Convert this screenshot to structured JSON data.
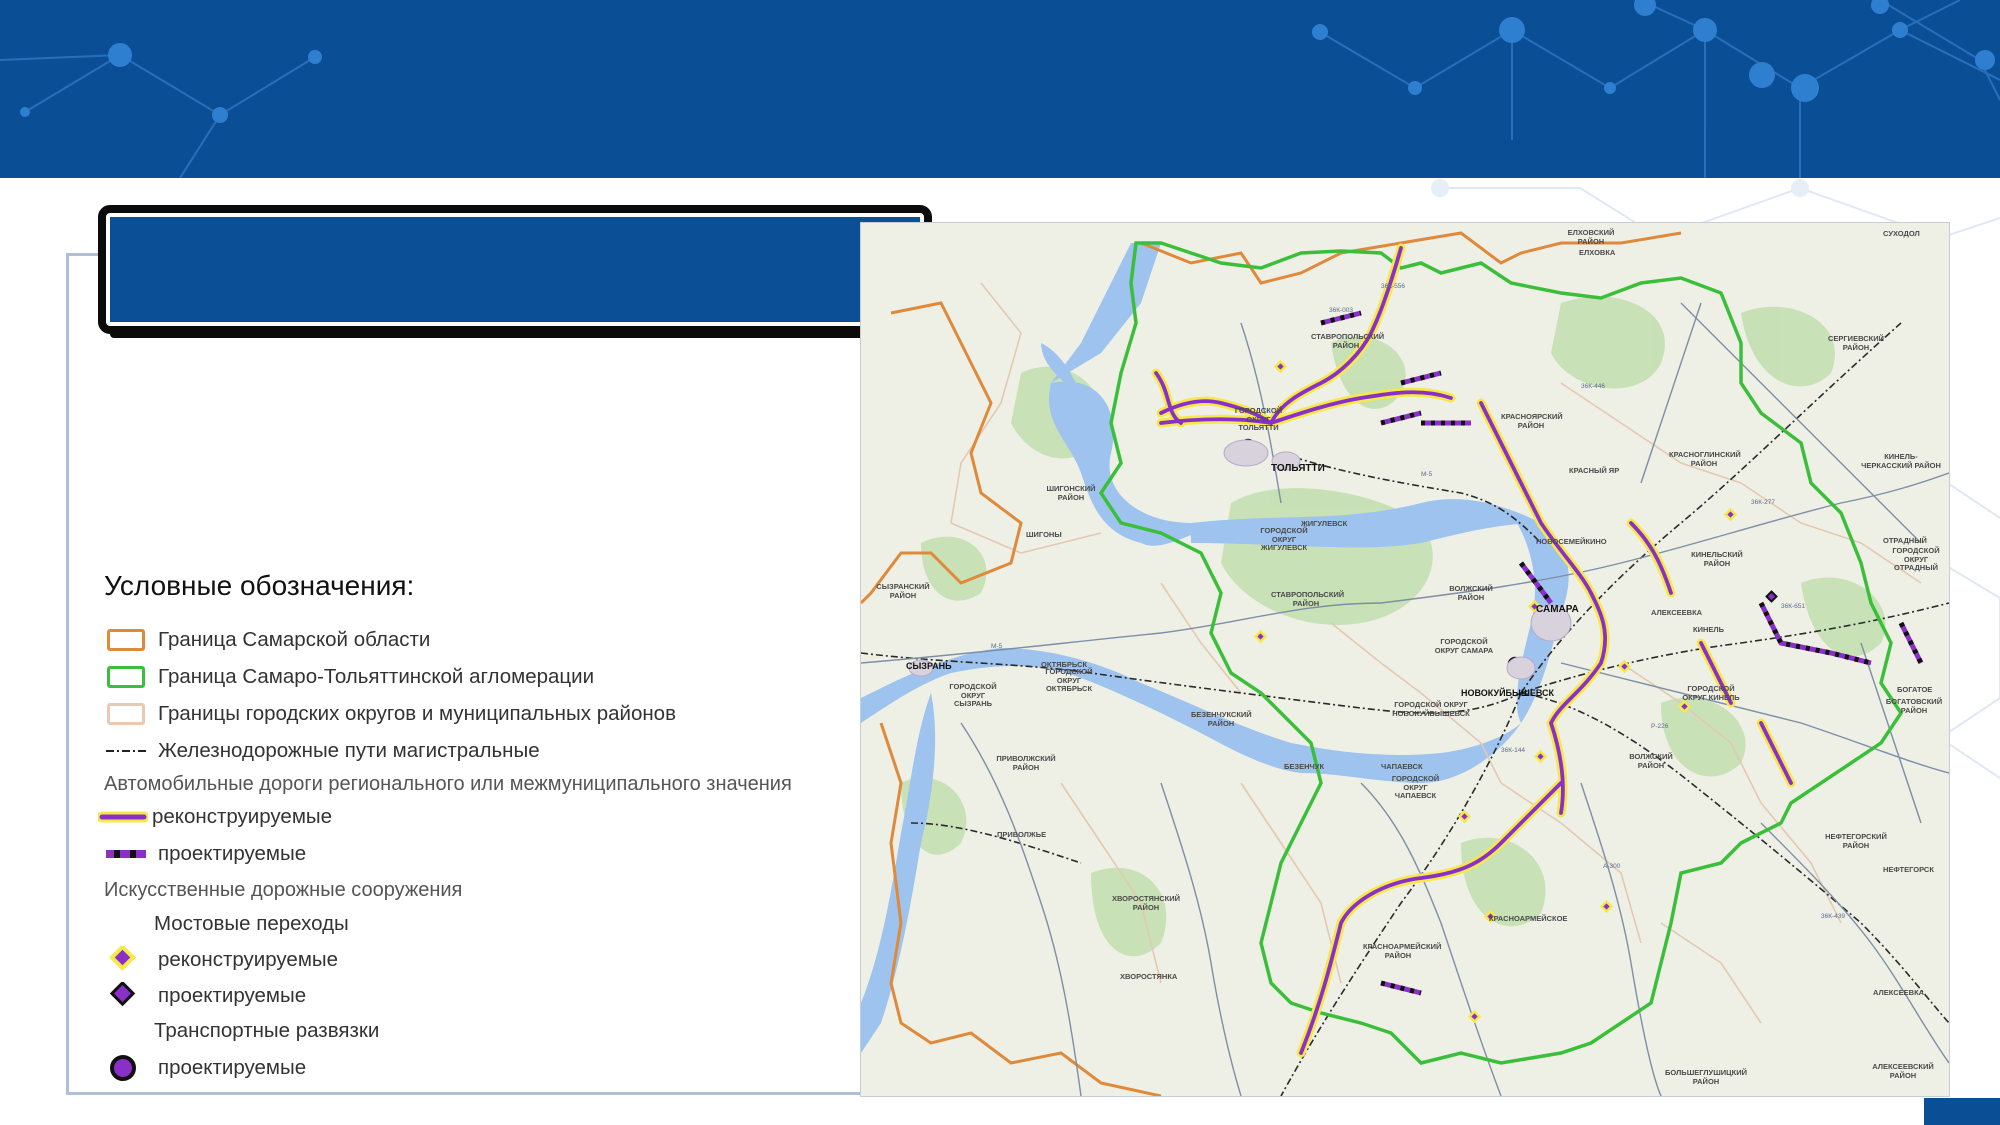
{
  "colors": {
    "header": "#0a4f96",
    "title_box": "#0b4f97",
    "region_border": "#e0893a",
    "agglomeration_border": "#3bbf3b",
    "district_border": "#e8c9b4",
    "road_reconstructed_fill": "#8b2fc9",
    "road_reconstructed_halo": "#f5e94a",
    "water": "#9ec3ef",
    "forest": "#b9d9a8"
  },
  "title_box": {
    "text": ""
  },
  "legend": {
    "title": "Условные обозначения:",
    "region_border": "Граница Самарской области",
    "agglomeration_border": "Граница Самаро-Тольяттинской агломерации",
    "district_borders": "Границы городских округов и муниципальных районов",
    "railway": "Железнодорожные пути магистральные",
    "roads_heading": "Автомобильные дороги регионального или межмуниципального значения",
    "roads_reconstructed": "реконструируемые",
    "roads_planned": "проектируемые",
    "structures_heading": "Искусственные дорожные сооружения",
    "bridges_heading": "Мостовые переходы",
    "bridges_reconstructed": "реконструируемые",
    "bridges_planned": "проектируемые",
    "interchanges_heading": "Транспортные развязки",
    "interchanges_planned": "проектируемые"
  },
  "map": {
    "cities": {
      "samara": "САМАРА",
      "tolyatti": "ТОЛЬЯТТИ",
      "novokuybyshevsk": "НОВОКУЙБЫШЕВСК",
      "syzran": "СЫЗРАНЬ",
      "zhigulevsk": "ЖИГУЛЕВСК",
      "chapaevsk": "ЧАПАЕВСК",
      "novosemeykino": "НОВОСЕМЕЙКИНО",
      "kinel": "КИНЕЛЬ",
      "alekseevka": "АЛЕКСЕЕВКА",
      "krasnoarmeyskoe": "КРАСНОАРМЕЙСКОЕ",
      "oktyabrsk": "ОКТЯБРЬСК",
      "shigony": "ШИГОНЫ",
      "privolzhye": "ПРИВОЛЖЬЕ",
      "bezenchuk": "БЕЗЕНЧУК",
      "khvorostyanka": "ХВОРОСТЯНКА",
      "krasny_yar": "КРАСНЫЙ ЯР",
      "elkhovka": "ЕЛХОВКА",
      "sukhodol": "СУХОДОЛ",
      "otradny": "ОТРАДНЫЙ",
      "bogatoe": "БОГАТОЕ",
      "neftegorsk": "НЕФТЕГОРСК",
      "alekseevka2": "АЛЕКСЕЕВКА"
    },
    "districts": {
      "stavropolsky": "СТАВРОПОЛЬСКИЙ РАЙОН",
      "go_tolyatti": "ГОРОДСКОЙ ОКРУГ ТОЛЬЯТТИ",
      "go_zhigulevsk": "ГОРОДСКОЙ ОКРУГ ЖИГУЛЕВСК",
      "stavropolsky2": "СТАВРОПОЛЬСКИЙ РАЙОН",
      "shigonsky": "ШИГОНСКИЙ РАЙОН",
      "syzransky": "СЫЗРАНСКИЙ РАЙОН",
      "go_syzran": "ГОРОДСКОЙ ОКРУГ СЫЗРАНЬ",
      "go_oktyabrsk": "ГОРОДСКОЙ ОКРУГ ОКТЯБРЬСК",
      "privolzhsky": "ПРИВОЛЖСКИЙ РАЙОН",
      "volzhsky": "ВОЛЖСКИЙ РАЙОН",
      "go_samara": "ГОРОДСКОЙ ОКРУГ САМАРА",
      "go_novokuyb": "ГОРОДСКОЙ ОКРУГ НОВОКУЙБЫШЕВСК",
      "bezenchuksky": "БЕЗЕНЧУКСКИЙ РАЙОН",
      "go_chapaevsk": "ГОРОДСКОЙ ОКРУГ ЧАПАЕВСК",
      "volzhsky2": "ВОЛЖСКИЙ РАЙОН",
      "krasnoyarsky": "КРАСНОЯРСКИЙ РАЙОН",
      "krasnoarmeysky": "КРАСНОАРМЕЙСКИЙ РАЙОН",
      "khvorostyansky": "ХВОРОСТЯНСКИЙ РАЙОН",
      "kinelsky": "КИНЕЛЬСКИЙ РАЙОН",
      "go_kinel": "ГОРОДСКОЙ ОКРУГ КИНЕЛЬ",
      "krasnoglinsky": "КРАСНОГЛИНСКИЙ РАЙОН",
      "sergievsky": "СЕРГИЕВСКИЙ РАЙОН",
      "kinel_cherkassky": "КИНЕЛЬ-ЧЕРКАССКИЙ РАЙОН",
      "go_otradny": "ГОРОДСКОЙ ОКРУГ ОТРАДНЫЙ",
      "bogatovsky": "БОГАТОВСКИЙ РАЙОН",
      "neftegorsky": "НЕФТЕГОРСКИЙ РАЙОН",
      "alekseevsky": "АЛЕКСЕЕВСКИЙ РАЙОН",
      "bolsheglushitsky": "БОЛЬШЕГЛУШИЦКИЙ РАЙОН",
      "elkhovsky": "ЕЛХОВСКИЙ РАЙОН"
    },
    "roads": [
      "М-5",
      "М-5",
      "36К-003",
      "36К-446",
      "36К-556",
      "Р-226",
      "А-300",
      "36К-144",
      "36К-277",
      "36К-651",
      "36К-439"
    ]
  }
}
